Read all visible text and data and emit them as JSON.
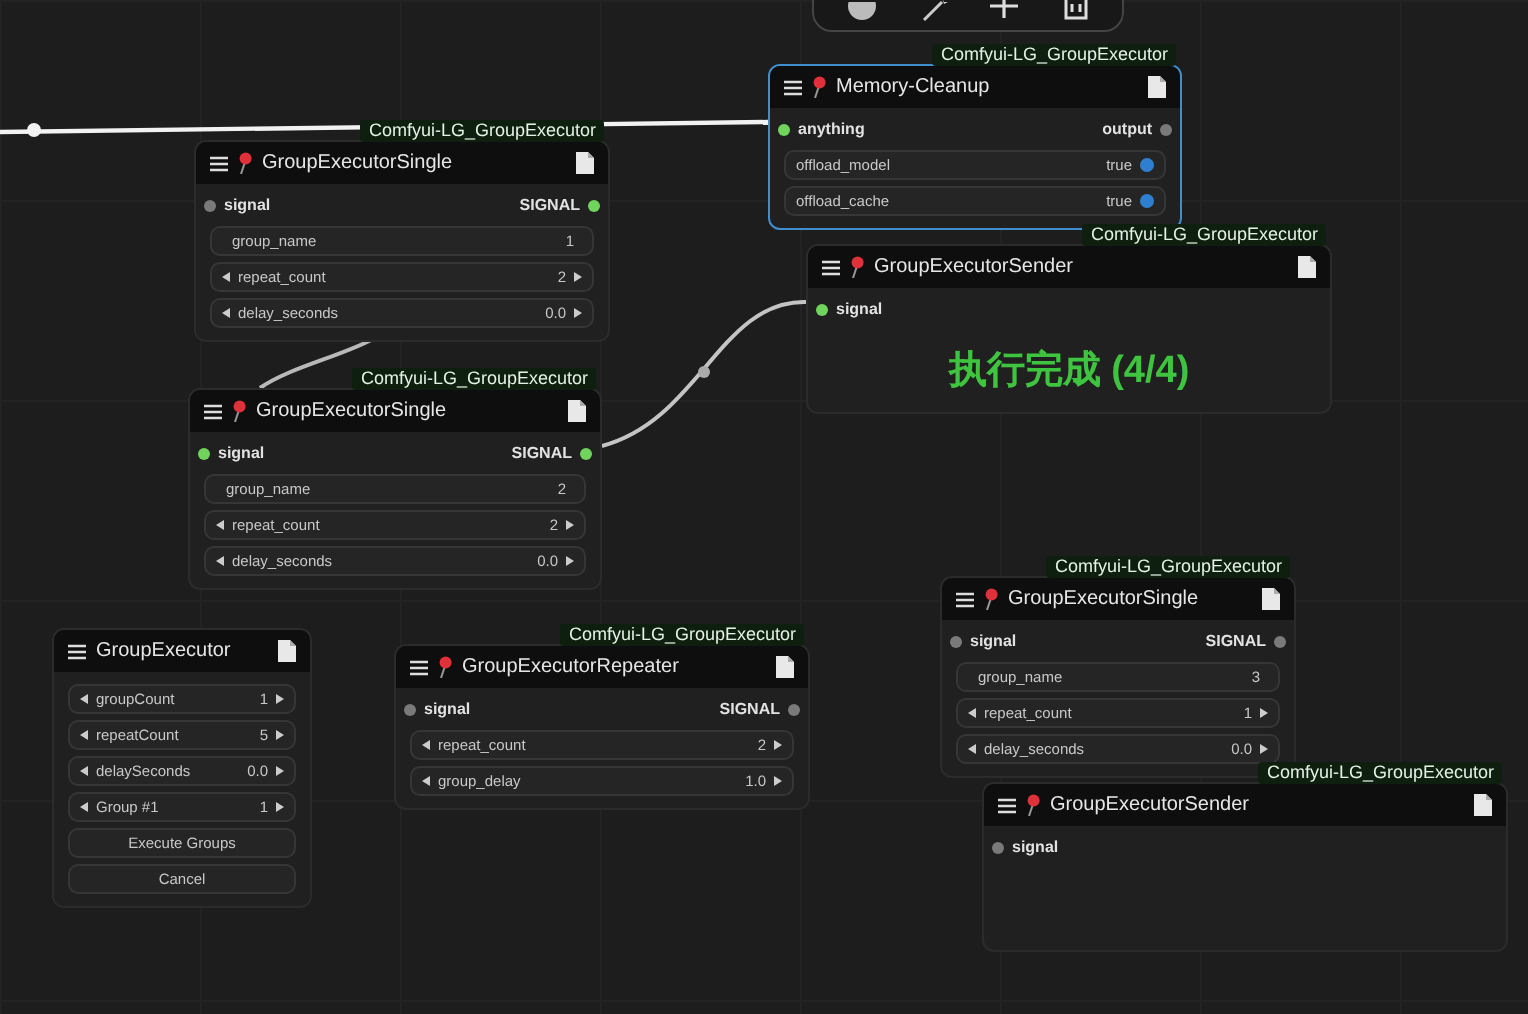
{
  "nodes": [
    {
      "badge": "Comfyui-LG_GroupExecutor",
      "title": "GroupExecutorSingle",
      "pin": true,
      "selected": false,
      "inputs": [
        {
          "name": "signal",
          "connected": false
        }
      ],
      "outputs": [
        {
          "name": "SIGNAL",
          "connected": true
        }
      ],
      "widgets": [
        {
          "kind": "text",
          "label": "group_name",
          "value": "1"
        },
        {
          "kind": "number",
          "label": "repeat_count",
          "value": "2"
        },
        {
          "kind": "number",
          "label": "delay_seconds",
          "value": "0.0"
        }
      ]
    },
    {
      "badge": "Comfyui-LG_GroupExecutor",
      "title": "Memory-Cleanup",
      "pin": true,
      "selected": true,
      "inputs": [
        {
          "name": "anything",
          "connected": true
        }
      ],
      "outputs": [
        {
          "name": "output",
          "connected": false
        }
      ],
      "widgets": [
        {
          "kind": "toggle",
          "label": "offload_model",
          "value": "true",
          "on": true
        },
        {
          "kind": "toggle",
          "label": "offload_cache",
          "value": "true",
          "on": true
        }
      ]
    },
    {
      "badge": "Comfyui-LG_GroupExecutor",
      "title": "GroupExecutorSender",
      "pin": true,
      "selected": false,
      "inputs": [
        {
          "name": "signal",
          "connected": true
        }
      ],
      "status": "执行完成 (4/4)"
    },
    {
      "badge": "Comfyui-LG_GroupExecutor",
      "title": "GroupExecutorSingle",
      "pin": true,
      "selected": false,
      "inputs": [
        {
          "name": "signal",
          "connected": true
        }
      ],
      "outputs": [
        {
          "name": "SIGNAL",
          "connected": true
        }
      ],
      "widgets": [
        {
          "kind": "text",
          "label": "group_name",
          "value": "2"
        },
        {
          "kind": "number",
          "label": "repeat_count",
          "value": "2"
        },
        {
          "kind": "number",
          "label": "delay_seconds",
          "value": "0.0"
        }
      ]
    },
    {
      "title": "GroupExecutor",
      "pin": false,
      "selected": false,
      "widgets": [
        {
          "kind": "number",
          "label": "groupCount",
          "value": "1"
        },
        {
          "kind": "number",
          "label": "repeatCount",
          "value": "5"
        },
        {
          "kind": "number",
          "label": "delaySeconds",
          "value": "0.0"
        },
        {
          "kind": "number",
          "label": "Group #1",
          "value": "1"
        },
        {
          "kind": "button",
          "label": "Execute Groups"
        },
        {
          "kind": "button",
          "label": "Cancel"
        }
      ]
    },
    {
      "badge": "Comfyui-LG_GroupExecutor",
      "title": "GroupExecutorRepeater",
      "pin": true,
      "selected": false,
      "inputs": [
        {
          "name": "signal",
          "connected": false
        }
      ],
      "outputs": [
        {
          "name": "SIGNAL",
          "connected": false
        }
      ],
      "widgets": [
        {
          "kind": "number",
          "label": "repeat_count",
          "value": "2"
        },
        {
          "kind": "number",
          "label": "group_delay",
          "value": "1.0"
        }
      ]
    },
    {
      "badge": "Comfyui-LG_GroupExecutor",
      "title": "GroupExecutorSingle",
      "pin": true,
      "selected": false,
      "inputs": [
        {
          "name": "signal",
          "connected": false
        }
      ],
      "outputs": [
        {
          "name": "SIGNAL",
          "connected": false
        }
      ],
      "widgets": [
        {
          "kind": "text",
          "label": "group_name",
          "value": "3"
        },
        {
          "kind": "number",
          "label": "repeat_count",
          "value": "1"
        },
        {
          "kind": "number",
          "label": "delay_seconds",
          "value": "0.0"
        }
      ]
    },
    {
      "badge": "Comfyui-LG_GroupExecutor",
      "title": "GroupExecutorSender",
      "pin": true,
      "selected": false,
      "inputs": [
        {
          "name": "signal",
          "connected": false
        }
      ]
    }
  ]
}
